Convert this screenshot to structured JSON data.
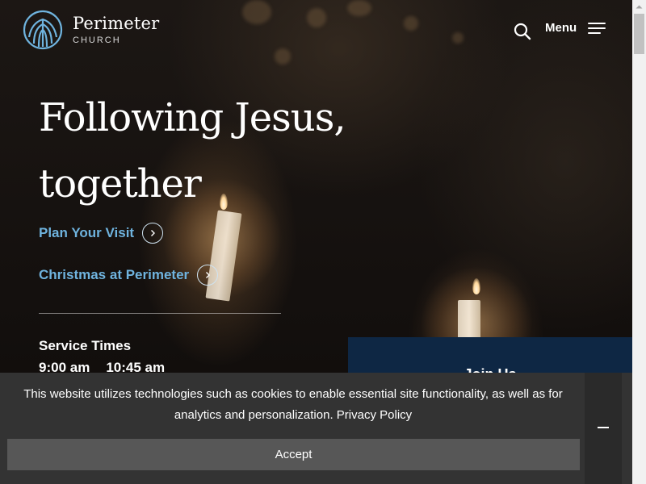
{
  "header": {
    "logo_name": "Perimeter",
    "logo_sub": "CHURCH",
    "search_icon": "search-icon",
    "menu_label": "Menu",
    "menu_icon": "hamburger-icon"
  },
  "hero": {
    "headline_line1": "Following Jesus,",
    "headline_line2": "together",
    "links": [
      {
        "label": "Plan Your Visit",
        "icon": "chevron-right-circle-icon"
      },
      {
        "label": "Christmas at Perimeter",
        "icon": "chevron-right-circle-icon"
      }
    ],
    "service_times_title": "Service Times",
    "service_times": [
      "9:00 am",
      "10:45 am"
    ]
  },
  "join_panel": {
    "title": "Join Us"
  },
  "cookie_banner": {
    "message": "This website utilizes technologies such as cookies to enable essential site functionality, as well as for analytics and personalization.",
    "privacy_link": "Privacy Policy",
    "accept_label": "Accept",
    "minimize_icon": "minimize-icon"
  },
  "colors": {
    "link_blue": "#6fb3de",
    "panel_navy": "#0e2744",
    "cookie_bg": "#333333",
    "accept_bg": "#575757"
  }
}
